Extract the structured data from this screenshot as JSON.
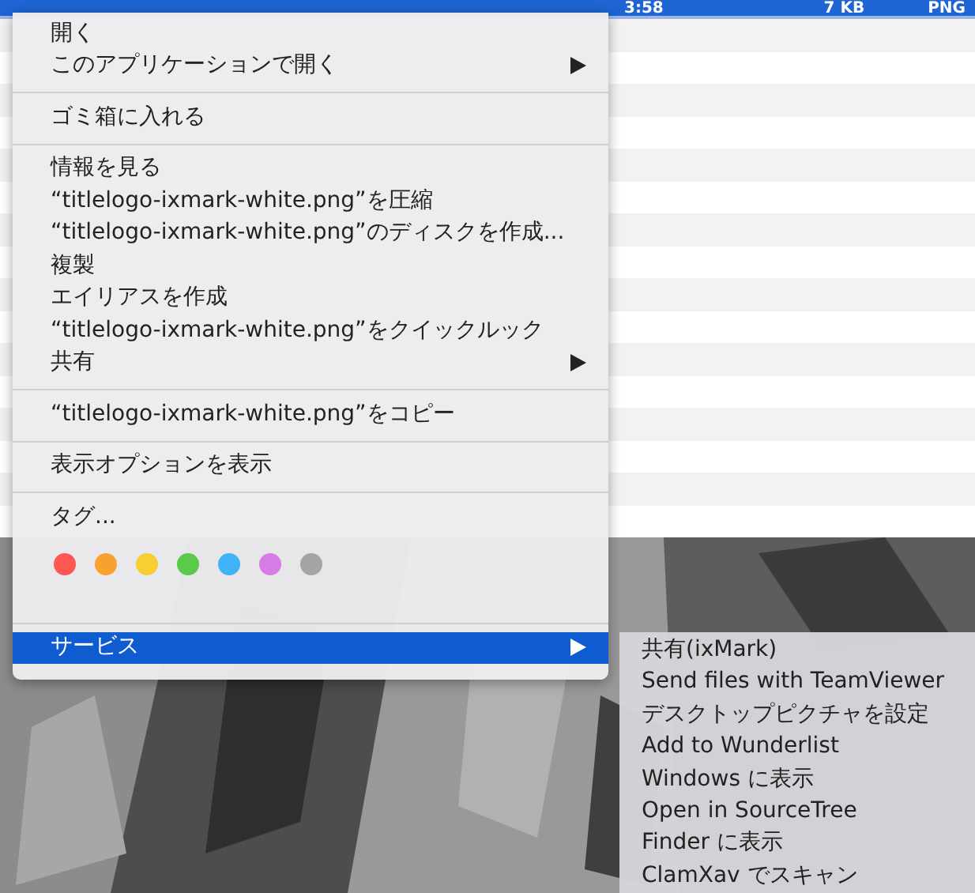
{
  "file_list": {
    "selected_row": {
      "selected": true,
      "cells": [
        "3:58",
        "7 KB",
        "PNG"
      ]
    }
  },
  "context_menu": {
    "groups": [
      {
        "items": [
          {
            "kind": "item",
            "label": "開く",
            "submenu": false,
            "selected": false
          },
          {
            "kind": "item",
            "label": "このアプリケーションで開く",
            "submenu": true,
            "selected": false
          }
        ]
      },
      {
        "items": [
          {
            "kind": "item",
            "label": "ゴミ箱に入れる",
            "submenu": false,
            "selected": false
          }
        ]
      },
      {
        "items": [
          {
            "kind": "item",
            "label": "情報を見る",
            "submenu": false,
            "selected": false
          },
          {
            "kind": "item",
            "label": "“titlelogo-ixmark-white.png”を圧縮",
            "submenu": false,
            "selected": false
          },
          {
            "kind": "item",
            "label": "“titlelogo-ixmark-white.png”のディスクを作成...",
            "submenu": false,
            "selected": false
          },
          {
            "kind": "item",
            "label": "複製",
            "submenu": false,
            "selected": false
          },
          {
            "kind": "item",
            "label": "エイリアスを作成",
            "submenu": false,
            "selected": false
          },
          {
            "kind": "item",
            "label": "“titlelogo-ixmark-white.png”をクイックルック",
            "submenu": false,
            "selected": false
          },
          {
            "kind": "item",
            "label": "共有",
            "submenu": true,
            "selected": false
          }
        ]
      },
      {
        "items": [
          {
            "kind": "item",
            "label": "“titlelogo-ixmark-white.png”をコピー",
            "submenu": false,
            "selected": false
          }
        ]
      },
      {
        "items": [
          {
            "kind": "item",
            "label": "表示オプションを表示",
            "submenu": false,
            "selected": false
          }
        ]
      },
      {
        "items": [
          {
            "kind": "item",
            "label": "タグ...",
            "submenu": false,
            "selected": false
          },
          {
            "kind": "tag_colors",
            "tags": [
              {
                "color": "#fc5753"
              },
              {
                "color": "#f8a12e"
              },
              {
                "color": "#f6d033"
              },
              {
                "color": "#5bc94a"
              },
              {
                "color": "#40b3f6"
              },
              {
                "color": "#d57ce6"
              },
              {
                "color": "#a5a5a7"
              }
            ]
          }
        ]
      },
      {
        "items": [
          {
            "kind": "item",
            "label": "サービス",
            "submenu": true,
            "selected": true
          }
        ]
      }
    ]
  },
  "services_submenu": {
    "items": [
      "共有(ixMark)",
      "Send files with TeamViewer",
      "デスクトップピクチャを設定",
      "Add to Wunderlist",
      "Windows に表示",
      "Open in SourceTree",
      "Finder に表示",
      "ClamXav でスキャン"
    ]
  }
}
